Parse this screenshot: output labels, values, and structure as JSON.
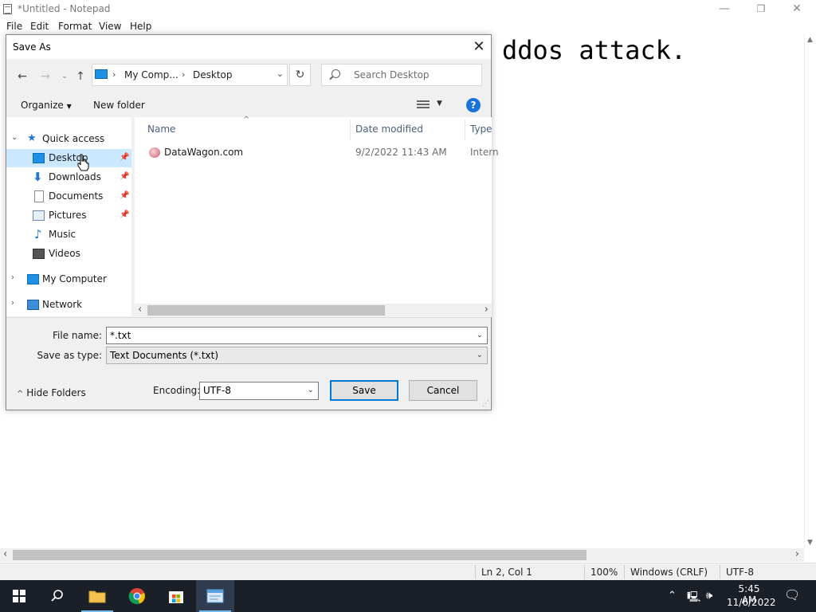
{
  "notepad": {
    "title": "*Untitled - Notepad",
    "menu": [
      "File",
      "Edit",
      "Format",
      "View",
      "Help"
    ],
    "content": "ddos attack.",
    "status": {
      "position": "Ln 2, Col 1",
      "zoom": "100%",
      "line_ending": "Windows (CRLF)",
      "encoding": "UTF-8"
    },
    "window_controls": {
      "minimize": "—",
      "restore": "❐",
      "close": "✕"
    }
  },
  "dialog": {
    "title": "Save As",
    "address": {
      "segments": [
        "My Comp...",
        "Desktop"
      ]
    },
    "search_placeholder": "Search Desktop",
    "toolbar": {
      "organize": "Organize",
      "new_folder": "New folder"
    },
    "nav": [
      {
        "label": "Quick access",
        "icon": "star-icon"
      },
      {
        "label": "Desktop",
        "icon": "desktop-icon",
        "pinned": true,
        "selected": true
      },
      {
        "label": "Downloads",
        "icon": "download-icon",
        "pinned": true
      },
      {
        "label": "Documents",
        "icon": "documents-icon",
        "pinned": true
      },
      {
        "label": "Pictures",
        "icon": "pictures-icon",
        "pinned": true
      },
      {
        "label": "Music",
        "icon": "music-icon"
      },
      {
        "label": "Videos",
        "icon": "videos-icon"
      },
      {
        "label": "My Computer",
        "icon": "computer-icon"
      },
      {
        "label": "Network",
        "icon": "network-icon"
      }
    ],
    "columns": [
      "Name",
      "Date modified",
      "Type"
    ],
    "files": [
      {
        "name": "DataWagon.com",
        "date": "9/2/2022 11:43 AM",
        "type": "Intern"
      }
    ],
    "file_name_label": "File name:",
    "file_name_value": "*.txt",
    "save_type_label": "Save as type:",
    "save_type_value": "Text Documents (*.txt)",
    "hide_folders": "Hide Folders",
    "encoding_label": "Encoding:",
    "encoding_value": "UTF-8",
    "save_button": "Save",
    "cancel_button": "Cancel"
  },
  "taskbar": {
    "time": "5:45 AM",
    "date": "11/6/2022"
  }
}
